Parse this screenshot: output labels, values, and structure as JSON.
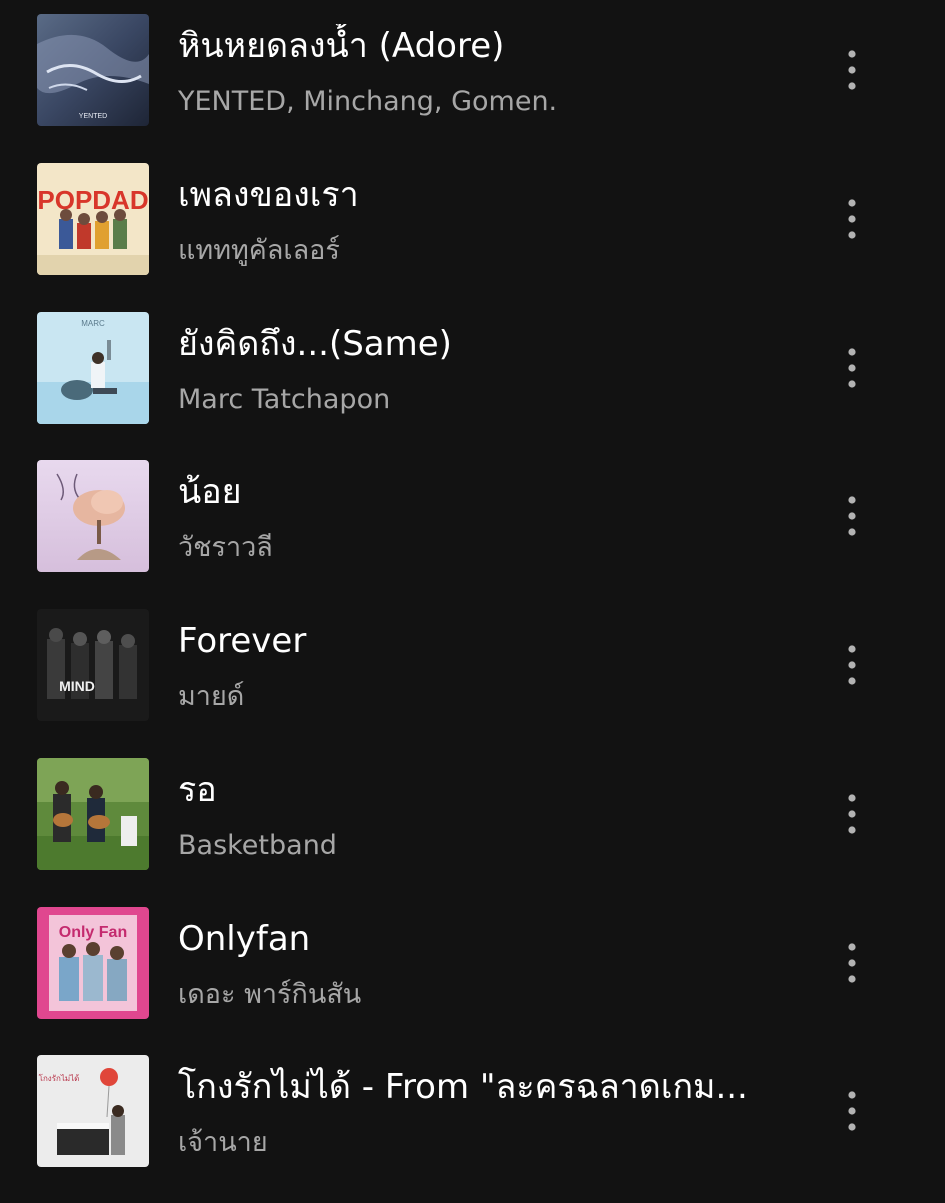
{
  "tracks": [
    {
      "title": "หินหยดลงน้ำ (Adore)",
      "artist": "YENTED, Minchang, Gomen.",
      "cover_text": "YENTED",
      "cover_icon": "album-cover-blue-figure"
    },
    {
      "title": "เพลงของเรา",
      "artist": "แทททูคัลเลอร์",
      "cover_text": "POPDAD",
      "cover_icon": "album-cover-popdad"
    },
    {
      "title": "ยังคิดถึง...(Same)",
      "artist": "Marc Tatchapon",
      "cover_text": "MARC",
      "cover_icon": "album-cover-light-blue"
    },
    {
      "title": "น้อย",
      "artist": "วัชราวลี",
      "cover_text": "",
      "cover_icon": "album-cover-pastel-tree"
    },
    {
      "title": "Forever",
      "artist": "มายด์",
      "cover_text": "MIND",
      "cover_icon": "album-cover-band-bw"
    },
    {
      "title": "รอ",
      "artist": "Basketband",
      "cover_text": "",
      "cover_icon": "album-cover-guitar-garden"
    },
    {
      "title": "Onlyfan",
      "artist": "เดอะ พาร์กินสัน",
      "cover_text": "Only Fan",
      "cover_icon": "album-cover-pink"
    },
    {
      "title": "โกงรักไม่ได้ - From \"ละครฉลาดเกม...",
      "artist": "เจ้านาย",
      "cover_text": "โกงรักไม่ได้",
      "cover_icon": "album-cover-piano-balloon"
    }
  ],
  "more_icon": "more-vertical-icon",
  "colors": {
    "background": "#121212",
    "title": "#ffffff",
    "artist": "#a7a7a7"
  }
}
